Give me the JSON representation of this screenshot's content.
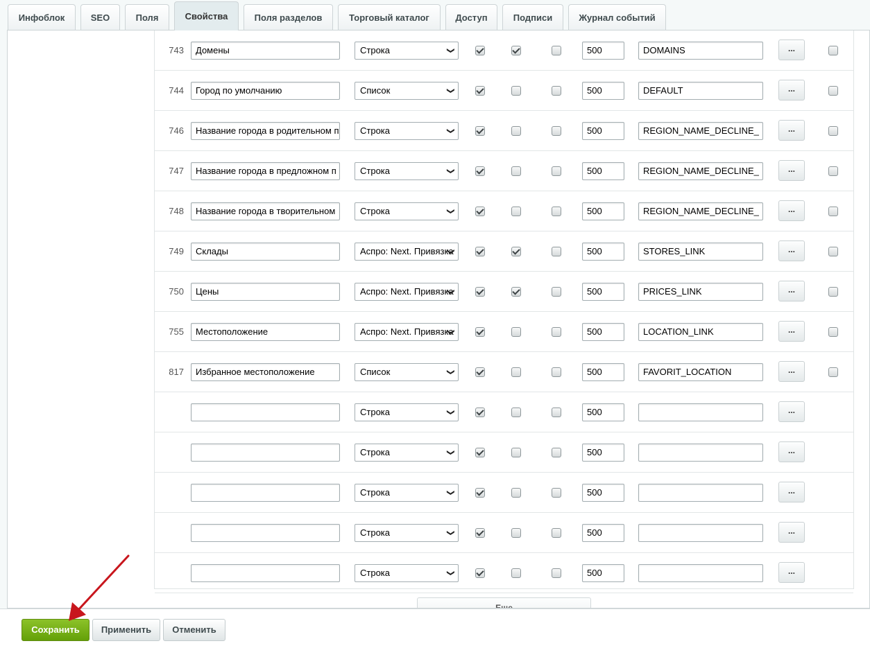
{
  "tabs": [
    {
      "label": "Инфоблок",
      "active": false
    },
    {
      "label": "SEO",
      "active": false
    },
    {
      "label": "Поля",
      "active": false
    },
    {
      "label": "Свойства",
      "active": true
    },
    {
      "label": "Поля разделов",
      "active": false
    },
    {
      "label": "Торговый каталог",
      "active": false
    },
    {
      "label": "Доступ",
      "active": false
    },
    {
      "label": "Подписи",
      "active": false
    },
    {
      "label": "Журнал событий",
      "active": false
    }
  ],
  "properties": [
    {
      "id": "743",
      "name": "Домены",
      "type": "Строка",
      "c1": true,
      "c2": true,
      "c3": false,
      "sort": "500",
      "code": "DOMAINS",
      "c4": false
    },
    {
      "id": "744",
      "name": "Город по умолчанию",
      "type": "Список",
      "c1": true,
      "c2": false,
      "c3": false,
      "sort": "500",
      "code": "DEFAULT",
      "c4": false
    },
    {
      "id": "746",
      "name": "Название города в родительном п",
      "type": "Строка",
      "c1": true,
      "c2": false,
      "c3": false,
      "sort": "500",
      "code": "REGION_NAME_DECLINE_",
      "c4": false
    },
    {
      "id": "747",
      "name": "Название города в предложном п",
      "type": "Строка",
      "c1": true,
      "c2": false,
      "c3": false,
      "sort": "500",
      "code": "REGION_NAME_DECLINE_",
      "c4": false
    },
    {
      "id": "748",
      "name": "Название города в творительном",
      "type": "Строка",
      "c1": true,
      "c2": false,
      "c3": false,
      "sort": "500",
      "code": "REGION_NAME_DECLINE_",
      "c4": false
    },
    {
      "id": "749",
      "name": "Склады",
      "type": "Аспро: Next. Привязка",
      "c1": true,
      "c2": true,
      "c3": false,
      "sort": "500",
      "code": "STORES_LINK",
      "c4": false
    },
    {
      "id": "750",
      "name": "Цены",
      "type": "Аспро: Next. Привязка",
      "c1": true,
      "c2": true,
      "c3": false,
      "sort": "500",
      "code": "PRICES_LINK",
      "c4": false
    },
    {
      "id": "755",
      "name": "Местоположение",
      "type": "Аспро: Next. Привязка",
      "c1": true,
      "c2": false,
      "c3": false,
      "sort": "500",
      "code": "LOCATION_LINK",
      "c4": false
    },
    {
      "id": "817",
      "name": "Избранное местоположение",
      "type": "Список",
      "c1": true,
      "c2": false,
      "c3": false,
      "sort": "500",
      "code": "FAVORIT_LOCATION",
      "c4": false
    },
    {
      "id": "",
      "name": "",
      "type": "Строка",
      "c1": true,
      "c2": false,
      "c3": false,
      "sort": "500",
      "code": "",
      "c4": null
    },
    {
      "id": "",
      "name": "",
      "type": "Строка",
      "c1": true,
      "c2": false,
      "c3": false,
      "sort": "500",
      "code": "",
      "c4": null
    },
    {
      "id": "",
      "name": "",
      "type": "Строка",
      "c1": true,
      "c2": false,
      "c3": false,
      "sort": "500",
      "code": "",
      "c4": null
    },
    {
      "id": "",
      "name": "",
      "type": "Строка",
      "c1": true,
      "c2": false,
      "c3": false,
      "sort": "500",
      "code": "",
      "c4": null
    },
    {
      "id": "",
      "name": "",
      "type": "Строка",
      "c1": true,
      "c2": false,
      "c3": false,
      "sort": "500",
      "code": "",
      "c4": null
    }
  ],
  "row_button_label": "...",
  "more_label": "Еще",
  "footer": {
    "save": "Сохранить",
    "apply": "Применить",
    "cancel": "Отменить"
  },
  "colors": {
    "accent_green": "#7ab51d",
    "arrow_red": "#c8161d"
  },
  "icons": {
    "select": "chevron-down-icon",
    "annotation": "red-arrow-icon"
  }
}
